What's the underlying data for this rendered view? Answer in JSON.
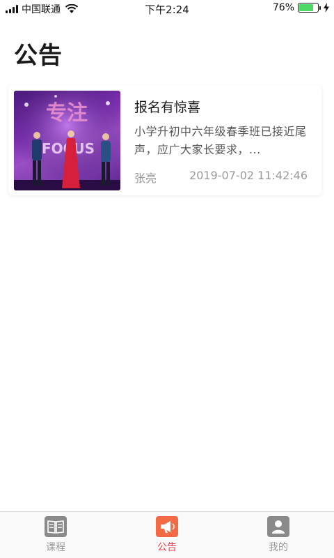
{
  "status_bar": {
    "carrier": "中国联通",
    "time": "下午2:24",
    "battery_percent": "76%",
    "battery_level": 0.76
  },
  "page": {
    "title": "公告"
  },
  "notices": [
    {
      "title": "报名有惊喜",
      "description": "小学升初中六年级春季班已接近尾声，应广大家长要求，...",
      "author": "张亮",
      "datetime": "2019-07-02 11:42:46",
      "thumbnail_text": "专注 FOCUS"
    }
  ],
  "tab_bar": {
    "tabs": [
      {
        "label": "课程",
        "icon": "book-icon",
        "active": false
      },
      {
        "label": "公告",
        "icon": "megaphone-icon",
        "active": true
      },
      {
        "label": "我的",
        "icon": "user-icon",
        "active": false
      }
    ],
    "colors": {
      "active": "#e8434f",
      "active_icon_bg": "#f26b45",
      "inactive": "#9a9a9a",
      "inactive_icon_bg": "#8a8a8a"
    }
  }
}
